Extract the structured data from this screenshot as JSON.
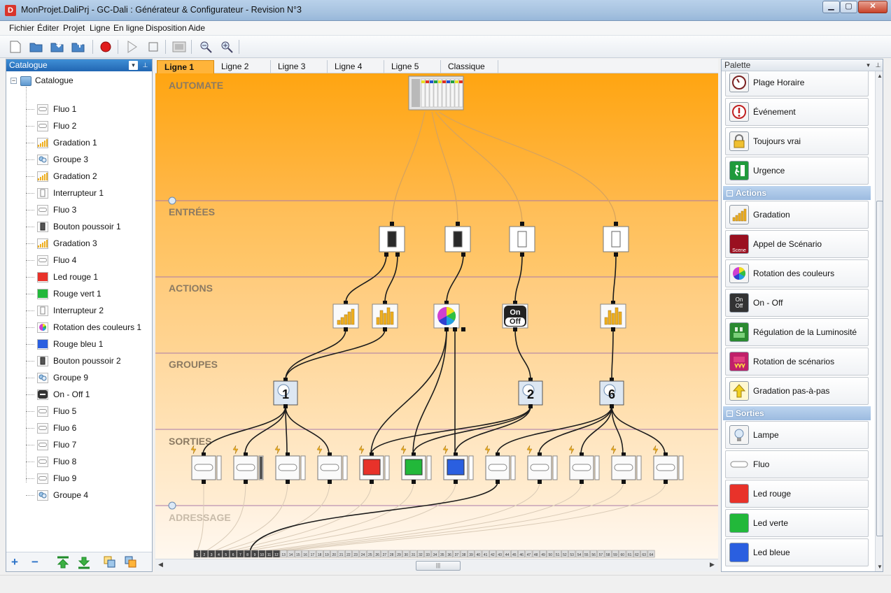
{
  "window": {
    "title": "MonProjet.DaliPrj - GC-Dali : Générateur & Configurateur - Revision N°3",
    "app_icon": "D"
  },
  "menu": [
    "Fichier",
    "Éditer",
    "Projet",
    "Ligne",
    "En ligne",
    "Disposition",
    "Aide"
  ],
  "toolbar": {
    "icons": [
      "new-file-icon",
      "open-folder-icon",
      "import-icon",
      "export-icon",
      "record-icon",
      "play-icon",
      "stop-icon",
      "device-icon",
      "zoom-out-icon",
      "zoom-in-icon"
    ],
    "record_color": "#e01d1d"
  },
  "catalogue": {
    "header": "Catalogue",
    "root": "Catalogue",
    "items": [
      {
        "label": "Fluo 1",
        "icon": "fluo-icon"
      },
      {
        "label": "Fluo 2",
        "icon": "fluo-icon"
      },
      {
        "label": "Gradation 1",
        "icon": "gradation-icon"
      },
      {
        "label": "Groupe 3",
        "icon": "group-icon"
      },
      {
        "label": "Gradation 2",
        "icon": "gradation-icon"
      },
      {
        "label": "Interrupteur 1",
        "icon": "switch-icon"
      },
      {
        "label": "Fluo 3",
        "icon": "fluo-icon"
      },
      {
        "label": "Bouton poussoir 1",
        "icon": "pushbutton-icon"
      },
      {
        "label": "Gradation 3",
        "icon": "gradation-icon"
      },
      {
        "label": "Fluo 4",
        "icon": "fluo-icon"
      },
      {
        "label": "Led rouge 1",
        "icon": "led-red-icon"
      },
      {
        "label": "Rouge vert 1",
        "icon": "led-green-icon"
      },
      {
        "label": "Interrupteur 2",
        "icon": "switch-icon"
      },
      {
        "label": "Rotation des couleurs 1",
        "icon": "color-wheel-icon"
      },
      {
        "label": "Rouge bleu 1",
        "icon": "led-blue-icon"
      },
      {
        "label": "Bouton poussoir 2",
        "icon": "pushbutton-icon"
      },
      {
        "label": "Groupe 9",
        "icon": "group-icon"
      },
      {
        "label": "On - Off 1",
        "icon": "onoff-icon"
      },
      {
        "label": "Fluo 5",
        "icon": "fluo-icon"
      },
      {
        "label": "Fluo 6",
        "icon": "fluo-icon"
      },
      {
        "label": "Fluo 7",
        "icon": "fluo-icon"
      },
      {
        "label": "Fluo 8",
        "icon": "fluo-icon"
      },
      {
        "label": "Fluo 9",
        "icon": "fluo-icon"
      },
      {
        "label": "Groupe 4",
        "icon": "group-icon"
      }
    ],
    "bottom_buttons": [
      "+",
      "−",
      "move-up-icon",
      "move-down-icon",
      "copy-icon",
      "paste-icon"
    ]
  },
  "tabs": [
    "Ligne 1",
    "Ligne 2",
    "Ligne 3",
    "Ligne 4",
    "Ligne 5",
    "Classique"
  ],
  "active_tab": "Ligne 1",
  "canvas": {
    "bands": [
      "AUTOMATE",
      "ENTRÉES",
      "ACTIONS",
      "GROUPES",
      "SORTIES",
      "ADRESSAGE"
    ],
    "group_numbers": [
      "1",
      "2",
      "6"
    ],
    "onoff_label": [
      "On",
      "Off"
    ],
    "address_numbers": [
      "1",
      "2",
      "3",
      "4",
      "5",
      "6",
      "7",
      "8",
      "9",
      "10",
      "11",
      "12",
      "13",
      "14",
      "15",
      "16",
      "17",
      "18",
      "19",
      "20",
      "21",
      "22",
      "23",
      "24",
      "25",
      "26",
      "27",
      "28",
      "29",
      "30",
      "31",
      "32",
      "33",
      "34",
      "35",
      "36",
      "37",
      "38",
      "39",
      "40",
      "41",
      "42",
      "43",
      "44",
      "45",
      "46",
      "47",
      "48",
      "49",
      "50",
      "51",
      "52",
      "53",
      "54",
      "55",
      "56",
      "57",
      "58",
      "59",
      "60",
      "61",
      "62",
      "63",
      "64"
    ],
    "colors": {
      "automate": "#ffa511",
      "red": "#e8322a",
      "green": "#22b83a",
      "blue": "#2a5fe0"
    }
  },
  "palette": {
    "header": "Palette",
    "items_top": [
      {
        "label": "Plage Horaire",
        "icon": "clock-icon"
      },
      {
        "label": "Événement",
        "icon": "event-icon"
      },
      {
        "label": "Toujours vrai",
        "icon": "lock-icon"
      },
      {
        "label": "Urgence",
        "icon": "emergency-exit-icon"
      }
    ],
    "cat_actions": "Actions",
    "items_actions": [
      {
        "label": "Gradation",
        "icon": "gradation-icon"
      },
      {
        "label": "Appel de Scénario",
        "icon": "scene-icon"
      },
      {
        "label": "Rotation des couleurs",
        "icon": "color-wheel-icon"
      },
      {
        "label": "On - Off",
        "icon": "onoff-icon"
      },
      {
        "label": "Régulation de la Luminosité",
        "icon": "luminosity-icon"
      },
      {
        "label": "Rotation de scénarios",
        "icon": "scene-rotation-icon"
      },
      {
        "label": "Gradation pas-à-pas",
        "icon": "arrow-up-icon"
      }
    ],
    "cat_sorties": "Sorties",
    "items_sorties": [
      {
        "label": "Lampe",
        "icon": "lamp-icon"
      },
      {
        "label": "Fluo",
        "icon": "fluo-icon"
      },
      {
        "label": "Led rouge",
        "icon": "led-red-icon"
      },
      {
        "label": "Led verte",
        "icon": "led-green-icon"
      },
      {
        "label": "Led bleue",
        "icon": "led-blue-icon"
      }
    ],
    "scene_text": "Scene",
    "onoff_text": [
      "On",
      "Off"
    ]
  },
  "hscroll_grip": "|||"
}
